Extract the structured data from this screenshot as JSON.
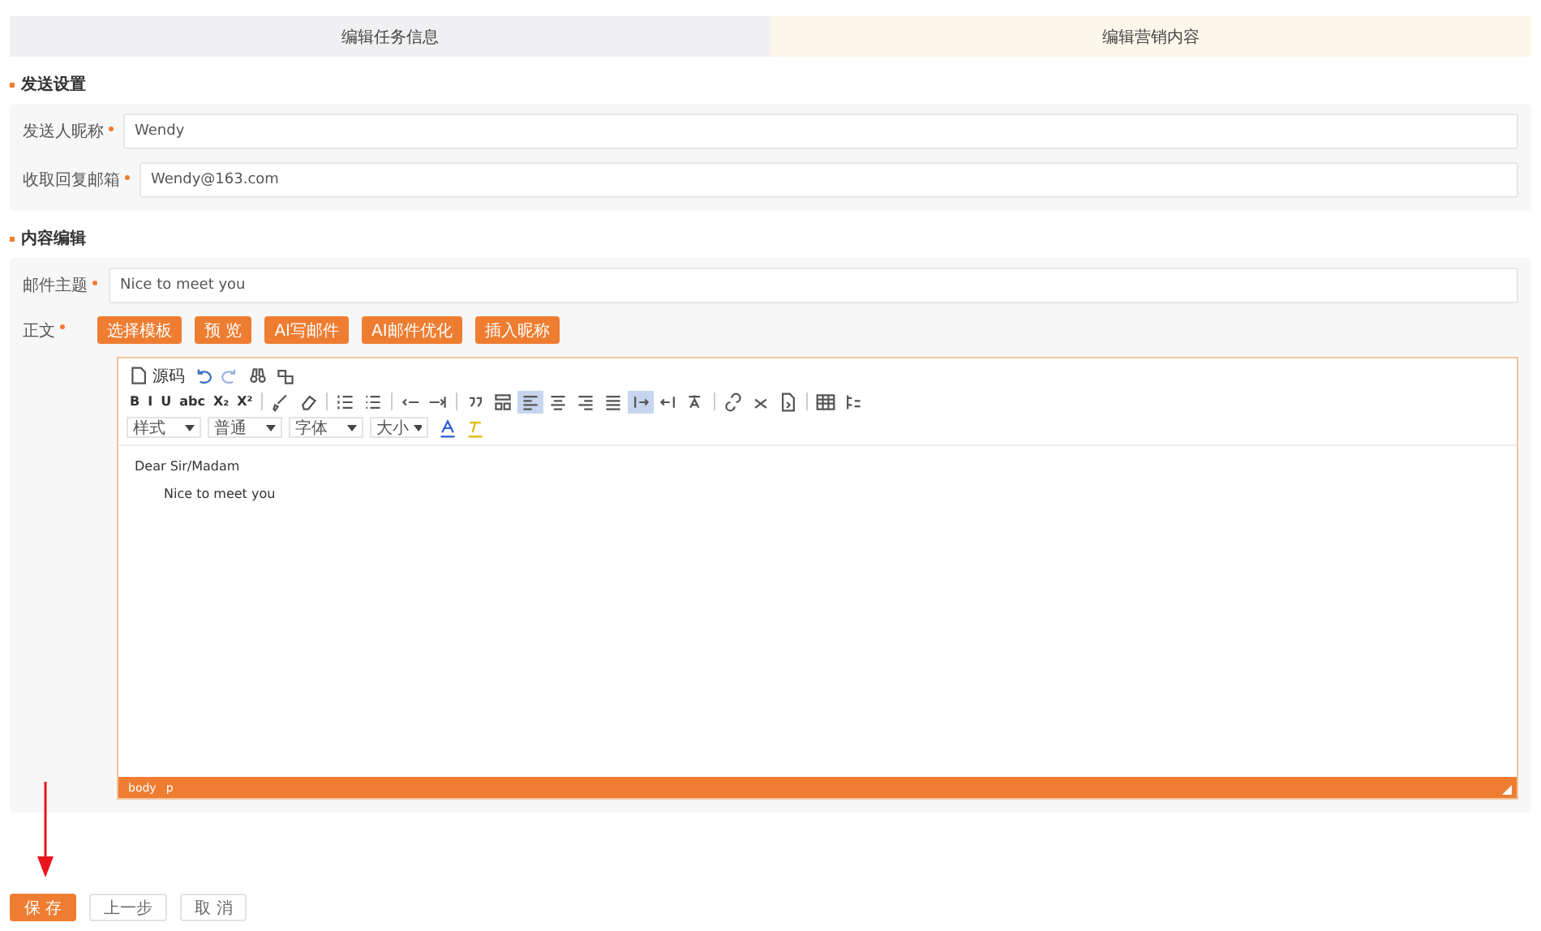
{
  "tabs": [
    {
      "label": "编辑任务信息",
      "selected": false
    },
    {
      "label": "编辑营销内容",
      "selected": true
    }
  ],
  "sections": [
    {
      "title": "发送设置",
      "fields": [
        {
          "label": "发送人昵称",
          "required": true,
          "value": "Wendy"
        },
        {
          "label": "收取回复邮箱",
          "required": true,
          "value": "Wendy@163.com"
        }
      ]
    },
    {
      "title": "内容编辑",
      "fields": [
        {
          "label": "邮件主题",
          "required": true,
          "value": "Nice to meet you"
        }
      ]
    }
  ],
  "body": {
    "label": "正文",
    "required": true,
    "buttons": [
      "选择模板",
      "预 览",
      "AI写邮件",
      "AI邮件优化",
      "插入昵称"
    ],
    "editor": {
      "toolbar": [
        [
          {
            "kind": "icon",
            "label": "源码",
            "selected": false
          },
          {
            "kind": "icon",
            "selected": false
          },
          {
            "kind": "icon",
            "selected": false
          },
          {
            "kind": "icon",
            "selected": false
          },
          {
            "kind": "icon",
            "selected": false
          }
        ],
        [
          {
            "kind": "glyph",
            "label": "B",
            "selected": false
          },
          {
            "kind": "glyph",
            "label": "I",
            "selected": false
          },
          {
            "kind": "glyph",
            "label": "U",
            "selected": false
          },
          {
            "kind": "glyph",
            "label": "abc",
            "selected": false
          },
          {
            "kind": "glyph",
            "label": "X₂",
            "selected": false
          },
          {
            "kind": "glyph",
            "label": "X²",
            "selected": false
          },
          {
            "kind": "sep"
          },
          {
            "kind": "icon",
            "selected": false
          },
          {
            "kind": "icon",
            "selected": false
          },
          {
            "kind": "sep"
          },
          {
            "kind": "icon",
            "selected": false
          },
          {
            "kind": "icon",
            "selected": false
          },
          {
            "kind": "sep"
          },
          {
            "kind": "icon",
            "selected": false
          },
          {
            "kind": "icon",
            "selected": false
          },
          {
            "kind": "sep"
          },
          {
            "kind": "icon",
            "selected": false
          },
          {
            "kind": "icon",
            "selected": false
          },
          {
            "kind": "icon",
            "selected": true
          },
          {
            "kind": "icon",
            "selected": false
          },
          {
            "kind": "icon",
            "selected": false
          },
          {
            "kind": "icon",
            "selected": false
          },
          {
            "kind": "icon",
            "selected": true
          },
          {
            "kind": "icon",
            "selected": false
          },
          {
            "kind": "icon",
            "selected": false
          },
          {
            "kind": "sep"
          },
          {
            "kind": "icon",
            "selected": false
          },
          {
            "kind": "icon",
            "selected": false
          },
          {
            "kind": "icon",
            "selected": false
          },
          {
            "kind": "sep"
          },
          {
            "kind": "icon",
            "selected": false
          },
          {
            "kind": "icon",
            "selected": false
          }
        ],
        [
          {
            "kind": "dropdown",
            "label": "样式"
          },
          {
            "kind": "dropdown",
            "label": "普通"
          },
          {
            "kind": "dropdown",
            "label": "字体"
          },
          {
            "kind": "dropdown",
            "label": "大小"
          },
          {
            "kind": "icon",
            "selected": false
          },
          {
            "kind": "icon",
            "selected": false
          }
        ]
      ],
      "paragraphs": [
        {
          "text": "Dear Sir/Madam",
          "indented": false
        },
        {
          "text": "Nice to meet you",
          "indented": true
        }
      ],
      "path": [
        "body",
        "p"
      ]
    }
  },
  "actions": [
    {
      "label": "保 存",
      "kind": "primary"
    },
    {
      "label": "上一步",
      "kind": "default"
    },
    {
      "label": "取 消",
      "kind": "default"
    }
  ]
}
